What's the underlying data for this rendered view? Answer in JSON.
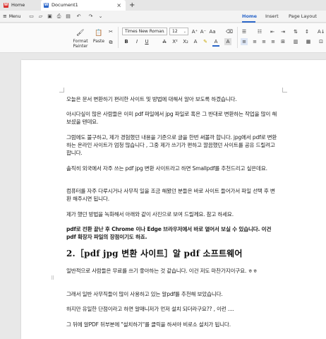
{
  "tabs": {
    "home": "Home",
    "document": "Document1",
    "close": "×",
    "add": "+"
  },
  "menubar": {
    "menu_label": "Menu",
    "tabs": [
      "Home",
      "Insert",
      "Page Layout"
    ],
    "active_tab": "Home"
  },
  "ribbon": {
    "format_painter": "Format Painter",
    "paste": "Paste",
    "font_name": "Times New Roman",
    "font_size": "12"
  },
  "document": {
    "paragraphs": [
      "오늘은 문서 변환하기 편리한 사이트 및 방법에 대해서 알아 보도록 하겠습니다.",
      "아시다싶이 많은 사람들은 이미 pdf 파일에서 jpg 파일로 혹은 그 반대로 변환하는 작업을 많이 해보셨을 텐데요.",
      "그럼에도 불구하고, 제가 경험했던 내용을 기준으로 글을 한번 써볼까 합니다. jpg에서 pdf로 변환하는 온라인 사이트가 엄청 많습니다 , 그중 제가 쓰기가 편하고 깔끔했던 사이트를 공유 드릴려고 합니다.",
      "솔직히 외국에서 자주 쓰는 pdf jpg 변환 사이트라고 하면 Smallpdf를 추천드리고 싶은데요.",
      "컴퓨터를 자주 다루시거나 사무직 일을 조금 해봤던 분들은 바로 사이트 들어가서 파일 선택 후 변환 해주시면 됩니다.",
      "제가 했던 방법을 녹화해서 아래와 같이 사진으로 보여 드릴께요. 참고 하세요.",
      "pdf로 전환 끝난 후 Chrome 이나 Edge 브라우저에서 바로 열어서 보실 수 있습니다. 이건 pdf 확장자 파일의 장점이기도 하죠.",
      "일반적으로 사람들은 무료를 쓰기 좋아하는 것 같습니다. 이건 저도 마찬가지이구요. ㅎㅎ",
      "그래서 일반 사무직들이 많이 사용하고 있는 알pdf를 추천해 보았습니다.",
      "하지만 유일한 단점이라고 하면 알매니저가 먼저 설치 되더라구요?? , 이런 ....",
      "그 뒤에 알PDF 뒤부분에 \"설치하기\"를 클릭을 하셔야 비로소 설치가 됩니다."
    ],
    "heading": "2.［pdf jpg 변환 사이트］알 pdf 소프트웨어"
  },
  "icons": [
    "wps-logo-icon",
    "word-doc-icon",
    "menu-icon",
    "save-icon",
    "undo-icon",
    "redo-icon",
    "paste-icon",
    "bold-icon",
    "italic-icon",
    "underline-icon"
  ]
}
